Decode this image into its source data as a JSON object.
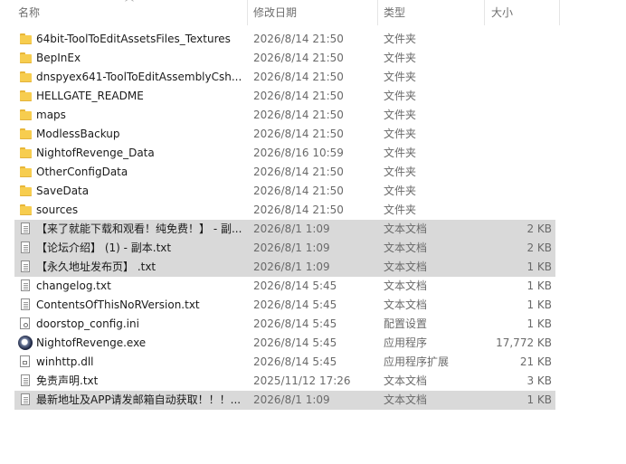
{
  "columns": {
    "name": "名称",
    "date": "修改日期",
    "type": "类型",
    "size": "大小"
  },
  "files": [
    {
      "name": "64bit-ToolToEditAssetsFiles_Textures",
      "date": "2026/8/14 21:50",
      "type": "文件夹",
      "size": "",
      "icon": "folder-icon",
      "selected": false
    },
    {
      "name": "BepInEx",
      "date": "2026/8/14 21:50",
      "type": "文件夹",
      "size": "",
      "icon": "folder-icon",
      "selected": false
    },
    {
      "name": "dnspyex641-ToolToEditAssemblyCsh...",
      "date": "2026/8/14 21:50",
      "type": "文件夹",
      "size": "",
      "icon": "folder-icon",
      "selected": false
    },
    {
      "name": "HELLGATE_README",
      "date": "2026/8/14 21:50",
      "type": "文件夹",
      "size": "",
      "icon": "folder-icon",
      "selected": false
    },
    {
      "name": "maps",
      "date": "2026/8/14 21:50",
      "type": "文件夹",
      "size": "",
      "icon": "folder-icon",
      "selected": false
    },
    {
      "name": "ModlessBackup",
      "date": "2026/8/14 21:50",
      "type": "文件夹",
      "size": "",
      "icon": "folder-icon",
      "selected": false
    },
    {
      "name": "NightofRevenge_Data",
      "date": "2026/8/16 10:59",
      "type": "文件夹",
      "size": "",
      "icon": "folder-icon",
      "selected": false
    },
    {
      "name": "OtherConfigData",
      "date": "2026/8/14 21:50",
      "type": "文件夹",
      "size": "",
      "icon": "folder-icon",
      "selected": false
    },
    {
      "name": "SaveData",
      "date": "2026/8/14 21:50",
      "type": "文件夹",
      "size": "",
      "icon": "folder-icon",
      "selected": false
    },
    {
      "name": "sources",
      "date": "2026/8/14 21:50",
      "type": "文件夹",
      "size": "",
      "icon": "folder-icon",
      "selected": false
    },
    {
      "name": "【来了就能下载和观看！纯免费！】 - 副...",
      "date": "2026/8/1 1:09",
      "type": "文本文档",
      "size": "2 KB",
      "icon": "text-file-icon",
      "selected": true
    },
    {
      "name": "【论坛介绍】 (1) - 副本.txt",
      "date": "2026/8/1 1:09",
      "type": "文本文档",
      "size": "2 KB",
      "icon": "text-file-icon",
      "selected": true
    },
    {
      "name": "【永久地址发布页】 .txt",
      "date": "2026/8/1 1:09",
      "type": "文本文档",
      "size": "1 KB",
      "icon": "text-file-icon",
      "selected": true
    },
    {
      "name": "changelog.txt",
      "date": "2026/8/14 5:45",
      "type": "文本文档",
      "size": "1 KB",
      "icon": "text-file-icon",
      "selected": false
    },
    {
      "name": "ContentsOfThisNoRVersion.txt",
      "date": "2026/8/14 5:45",
      "type": "文本文档",
      "size": "1 KB",
      "icon": "text-file-icon",
      "selected": false
    },
    {
      "name": "doorstop_config.ini",
      "date": "2026/8/14 5:45",
      "type": "配置设置",
      "size": "1 KB",
      "icon": "config-file-icon",
      "selected": false
    },
    {
      "name": "NightofRevenge.exe",
      "date": "2026/8/14 5:45",
      "type": "应用程序",
      "size": "17,772 KB",
      "icon": "app-icon",
      "selected": false
    },
    {
      "name": "winhttp.dll",
      "date": "2026/8/14 5:45",
      "type": "应用程序扩展",
      "size": "21 KB",
      "icon": "dll-file-icon",
      "selected": false
    },
    {
      "name": "免责声明.txt",
      "date": "2025/11/12 17:26",
      "type": "文本文档",
      "size": "3 KB",
      "icon": "text-file-icon",
      "selected": false
    },
    {
      "name": "最新地址及APP请发邮箱自动获取！！！...",
      "date": "2026/8/1 1:09",
      "type": "文本文档",
      "size": "1 KB",
      "icon": "text-file-icon",
      "selected": true
    }
  ]
}
